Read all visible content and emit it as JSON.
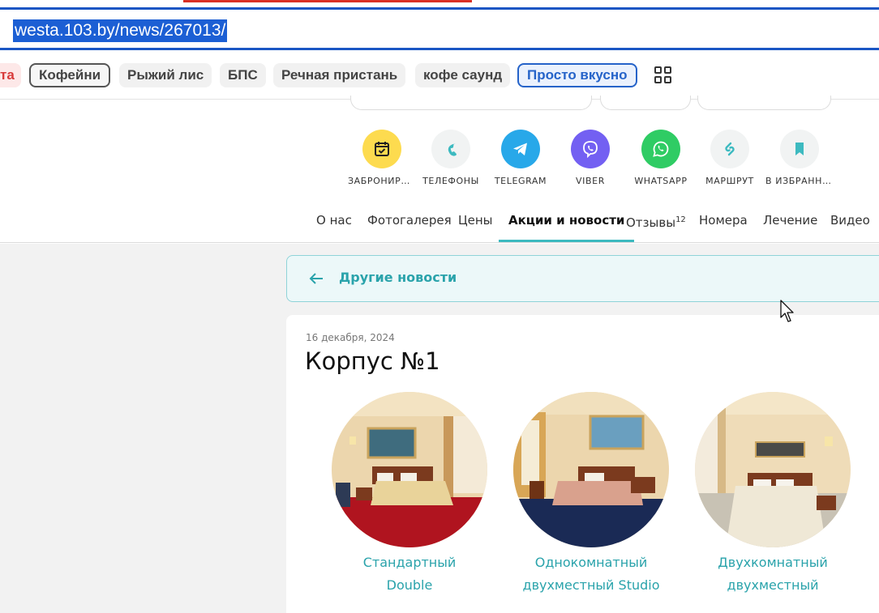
{
  "browser": {
    "url": "westa.103.by/news/267013/"
  },
  "chips": [
    {
      "label": "та",
      "style": "red"
    },
    {
      "label": "Кофейни",
      "style": "outlined"
    },
    {
      "label": "Рыжий лис",
      "style": "plain"
    },
    {
      "label": "БПС",
      "style": "plain"
    },
    {
      "label": "Речная пристань",
      "style": "plain"
    },
    {
      "label": "кофе саунд",
      "style": "plain"
    },
    {
      "label": "Просто вкусно",
      "style": "active"
    }
  ],
  "grid_icon": "apps-grid-icon",
  "actions": [
    {
      "label": "ЗАБРОНИРОВАТЬ",
      "icon": "calendar-icon",
      "color": "#fddb4f"
    },
    {
      "label": "ТЕЛЕФОНЫ",
      "icon": "phone-icon",
      "color": "#f1f3f3"
    },
    {
      "label": "TELEGRAM",
      "icon": "telegram-icon",
      "color": "#28a8e9"
    },
    {
      "label": "VIBER",
      "icon": "viber-icon",
      "color": "#7360f2"
    },
    {
      "label": "WHATSAPP",
      "icon": "whatsapp-icon",
      "color": "#2fcc64"
    },
    {
      "label": "МАРШРУТ",
      "icon": "route-icon",
      "color": "#f1f3f3"
    },
    {
      "label": "В ИЗБРАННОЕ",
      "icon": "bookmark-icon",
      "color": "#f1f3f3"
    }
  ],
  "nav": [
    {
      "label": "О нас"
    },
    {
      "label": "Фотогалерея"
    },
    {
      "label": "Цены"
    },
    {
      "label": "Акции и новости",
      "active": true
    },
    {
      "label": "Отзывы",
      "badge": "12"
    },
    {
      "label": "Номера"
    },
    {
      "label": "Лечение"
    },
    {
      "label": "Видео"
    }
  ],
  "back": {
    "label": "Другие новости"
  },
  "article": {
    "date": "16 декабря, 2024",
    "title": "Корпус №1"
  },
  "rooms": [
    {
      "line1": "Стандартный",
      "line2": "Double"
    },
    {
      "line1": "Однокомнатный",
      "line2": "двухместный Studio"
    },
    {
      "line1": "Двухкомнатный",
      "line2": "двухместный"
    }
  ],
  "colors": {
    "accent": "#2aa3ab",
    "browser_blue": "#1a56c4"
  }
}
